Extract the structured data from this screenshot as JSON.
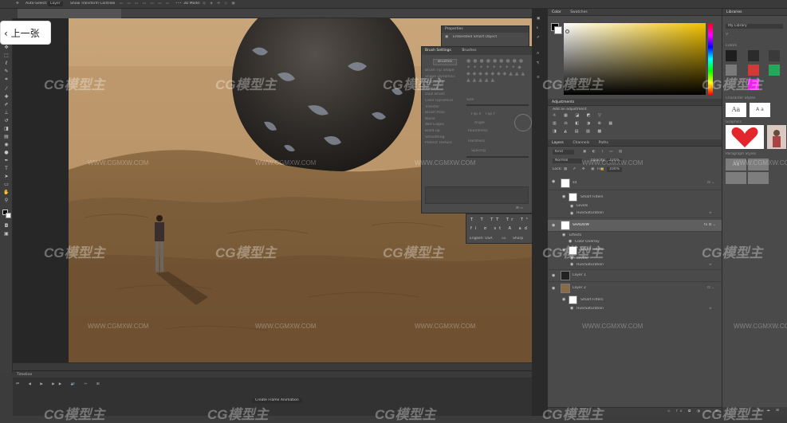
{
  "options_bar": {
    "auto_select": "Auto-Select:",
    "layer_dropdown": "Layer",
    "show_transform": "Show Transform Controls",
    "mode_3d": "3D Mode:"
  },
  "document_tab": {
    "title": "BIG SPHERE ALPHA.png @ 600% (SHADOW, RGB/16) *"
  },
  "back_button": {
    "label": "上一张"
  },
  "status_bar": {
    "zoom": "300%",
    "doc": "Doc: 8.87M/24.7M"
  },
  "timeline": {
    "title": "Timeline",
    "create_button": "Create Frame Animation"
  },
  "properties_panel": {
    "title": "Properties",
    "subtitle": "Embedded Smart Object"
  },
  "brush_settings": {
    "tabs": [
      "Brush Settings",
      "Brushes"
    ],
    "brushes_button": "Brushes",
    "options": [
      "Brush Tip Shape",
      "Shape Dynamics",
      "Scattering",
      "Texture",
      "Dual Brush",
      "Color Dynamics",
      "Transfer",
      "Brush Pose",
      "Noise",
      "Wet Edges",
      "Build-up",
      "Smoothing",
      "Protect Texture"
    ],
    "size_label": "Size",
    "flip_x": "Flip X",
    "flip_y": "Flip Y",
    "angle": "Angle",
    "roundness": "Roundness",
    "hardness": "Hardness",
    "spacing": "Spacing"
  },
  "character_panel": {
    "language": "English: USA",
    "aa": "Sharp",
    "aa_label": "aa"
  },
  "color_panel": {
    "tabs": [
      "Color",
      "Swatches"
    ],
    "hue_color": "#f2c200"
  },
  "adjustments_panel": {
    "title": "Adjustments",
    "subtitle": "Add an adjustment"
  },
  "layers_panel": {
    "tabs": [
      "Layers",
      "Channels",
      "Paths"
    ],
    "kind": "Kind",
    "blend_mode": "Normal",
    "opacity_label": "Opacity:",
    "opacity_value": "100%",
    "lock_label": "Lock:",
    "fill_label": "Fill:",
    "fill_value": "100%",
    "rows": [
      {
        "name": "sd",
        "indent": 0,
        "kind": "layer"
      },
      {
        "name": "Smart Filters",
        "indent": 1,
        "kind": "filter"
      },
      {
        "name": "Levels",
        "indent": 2,
        "kind": "sub"
      },
      {
        "name": "Hue/Saturation",
        "indent": 2,
        "kind": "sub"
      },
      {
        "name": "SHADOW",
        "indent": 0,
        "kind": "layer-selected"
      },
      {
        "name": "Effects",
        "indent": 1,
        "kind": "sub"
      },
      {
        "name": "Color Overlay",
        "indent": 2,
        "kind": "sub"
      },
      {
        "name": "Smart Filters",
        "indent": 1,
        "kind": "filter"
      },
      {
        "name": "Levels",
        "indent": 2,
        "kind": "sub"
      },
      {
        "name": "Hue/Saturation",
        "indent": 2,
        "kind": "sub"
      },
      {
        "name": "Layer 1",
        "indent": 0,
        "kind": "layer-dark"
      },
      {
        "name": "Layer 2",
        "indent": 0,
        "kind": "layer"
      },
      {
        "name": "Smart Filters",
        "indent": 1,
        "kind": "filter"
      },
      {
        "name": "Hue/Saturation",
        "indent": 2,
        "kind": "sub"
      }
    ]
  },
  "libraries_panel": {
    "title": "Libraries",
    "library_name": "My Library",
    "colors_label": "Colors",
    "character_styles_label": "Character Styles",
    "char_style_1": "Aa",
    "char_style_2": "A a",
    "graphics_label": "Graphics",
    "paragraph_styles_label": "Paragraph Styles",
    "para_style": "Aa",
    "swatches": [
      "#1e1e1e",
      "#2b2b2b",
      "#3a3a3a",
      "#d23a3a",
      "#26a85a",
      "#7a7a7a",
      "#ee22ee"
    ]
  },
  "watermarks": {
    "logo_text": "CG模型主",
    "url_text": "WWW.CGMXW.COM"
  }
}
